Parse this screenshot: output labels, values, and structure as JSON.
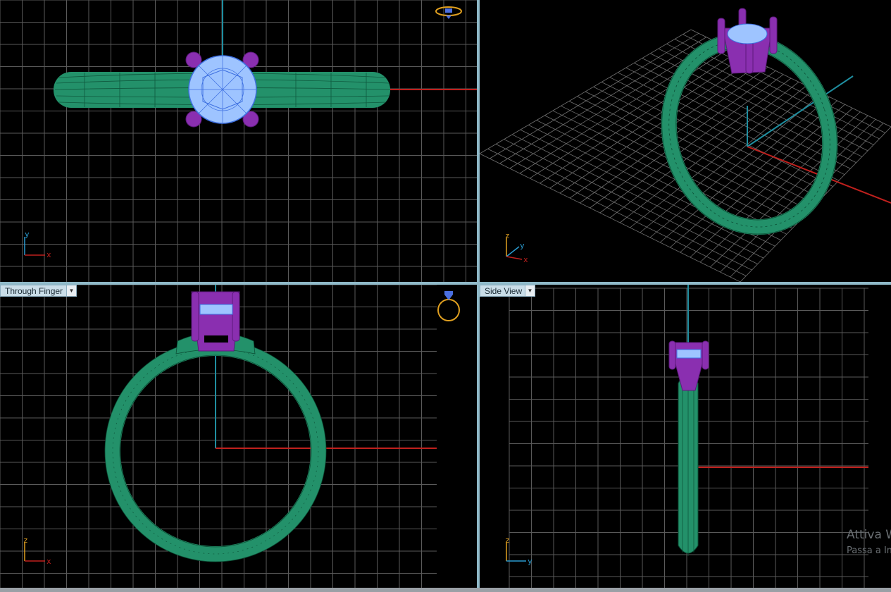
{
  "viewports": {
    "top": {
      "label": "",
      "axis_v": "y",
      "axis_h": "x"
    },
    "perspective": {
      "label": "",
      "axis_up": "z",
      "axis_y": "y",
      "axis_x": "x"
    },
    "through_finger": {
      "label": "Through Finger",
      "axis_v": "z",
      "axis_h": "x"
    },
    "side": {
      "label": "Side View",
      "axis_v": "z",
      "axis_h": "y"
    }
  },
  "watermark": {
    "line1": "Attiva W",
    "line2": "Passa a Im"
  },
  "colors": {
    "grid": "#5c5c5c",
    "x_axis": "#c0201d",
    "vertical_axis": "#1f8ea0",
    "band": "#23916a",
    "band_wire": "#0c4f36",
    "prongs": "#8a2fb0",
    "gem": "#9ec4ff",
    "gem_wire": "#3d6fe0",
    "splitter": "#8fb9c8"
  },
  "icons": [
    "ring-widget-icon",
    "dropdown-arrow-icon",
    "axis-gizmo-icon"
  ]
}
